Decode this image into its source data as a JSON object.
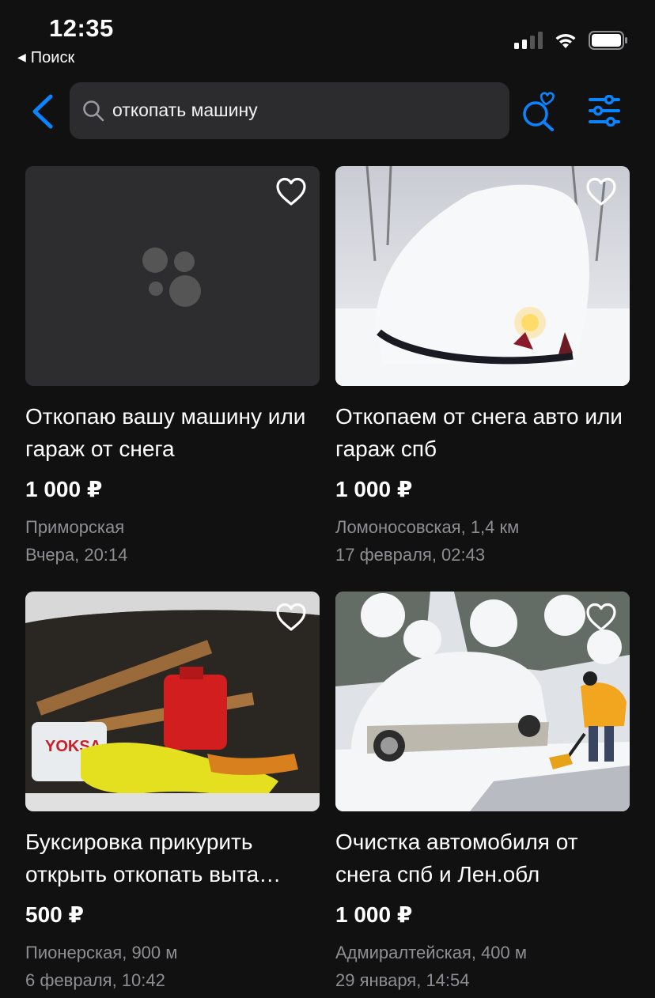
{
  "status_bar": {
    "time": "12:35",
    "back_app_label": "Поиск"
  },
  "search": {
    "query": "откопать машину"
  },
  "icons": {
    "back": "chevron-left-icon",
    "search": "search-icon",
    "saved_search": "search-heart-icon",
    "filters": "sliders-icon",
    "favorite": "heart-outline-icon"
  },
  "colors": {
    "accent": "#0a84ff",
    "background": "#111111",
    "search_field": "#2c2c2e",
    "secondary_text": "#8e8e93"
  },
  "listings": [
    {
      "title": "Откопаю вашу машину или гараж от снега",
      "price": "1 000 ₽",
      "location": "Приморская",
      "date": "Вчера, 20:14",
      "image": "placeholder"
    },
    {
      "title": "Откопаем от снега авто или гараж спб",
      "price": "1 000 ₽",
      "location": "Ломоносовская, 1,4 км",
      "date": "17 февраля, 02:43",
      "image": "snow-covered car"
    },
    {
      "title": "Буксировка прикурить открыть откопать выта…",
      "price": "500 ₽",
      "location": "Пионерская, 900 м",
      "date": "6 февраля, 10:42",
      "image": "car trunk with towing gear"
    },
    {
      "title": "Очистка автомобиля от снега спб и Лен.обл",
      "price": "1 000 ₽",
      "location": "Адмиралтейская, 400 м",
      "date": "29 января, 14:54",
      "image": "person shoveling snow near car"
    }
  ]
}
